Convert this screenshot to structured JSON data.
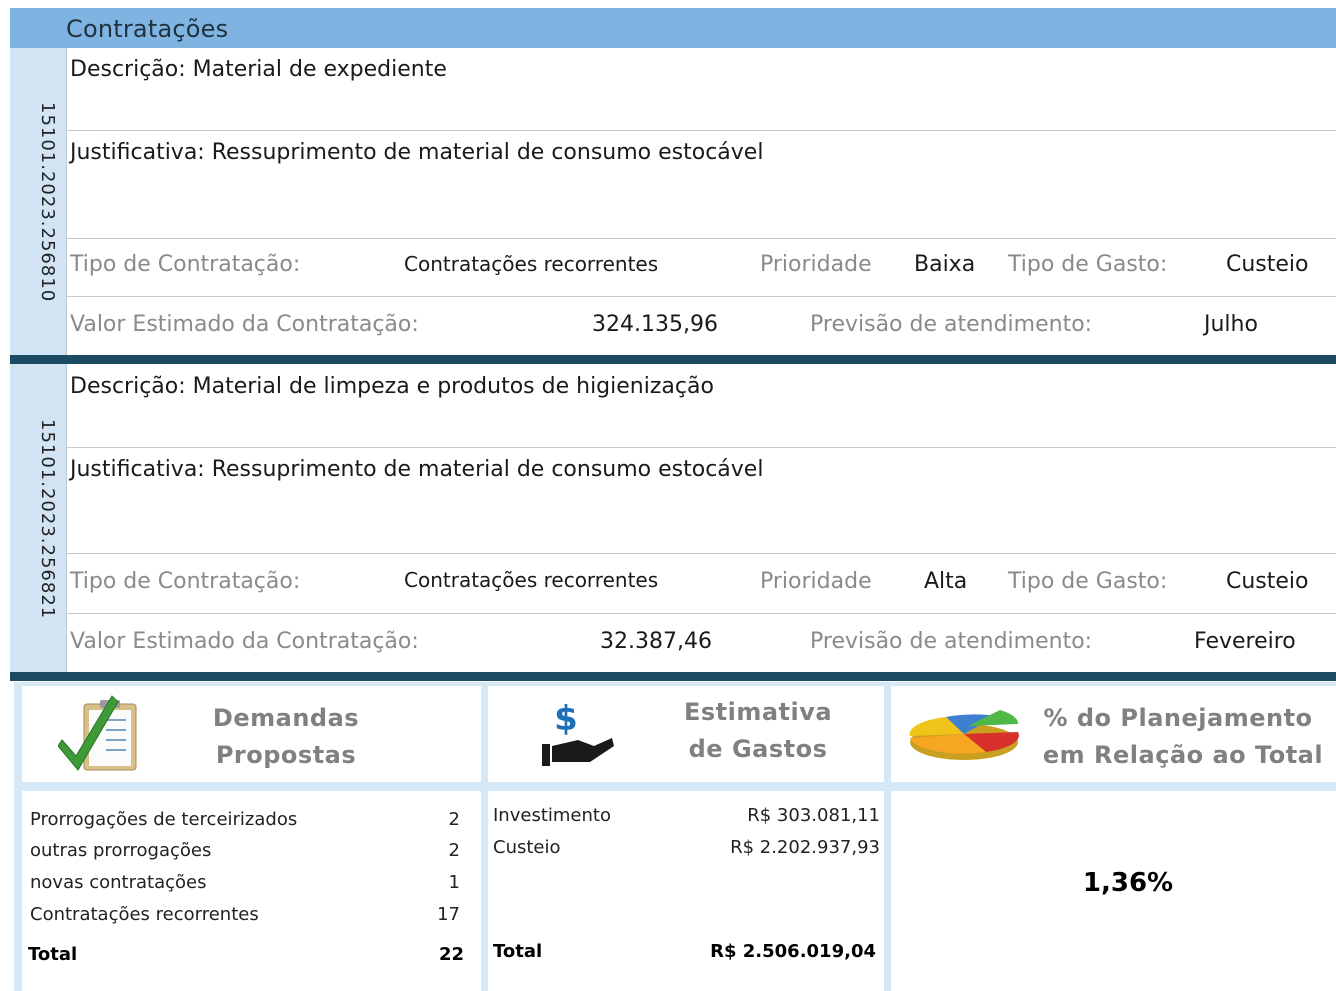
{
  "header": {
    "title": "Contratações"
  },
  "labels": {
    "tipo_contratacao": "Tipo de Contratação:",
    "prioridade": "Prioridade",
    "tipo_gasto": "Tipo de Gasto:",
    "valor_estimado": "Valor Estimado da Contratação:",
    "previsao": "Previsão de atendimento:"
  },
  "records": [
    {
      "id": "15101.2023.256810",
      "descricao": "Descrição: Material de expediente",
      "justificativa": "Justificativa: Ressuprimento de material de consumo estocável",
      "tipo_contratacao": "Contratações recorrentes",
      "prioridade": "Baixa",
      "tipo_gasto": "Custeio",
      "valor_estimado": "324.135,96",
      "previsao": "Julho"
    },
    {
      "id": "15101.2023.256821",
      "descricao": "Descrição: Material de limpeza e produtos de higienização",
      "justificativa": "Justificativa: Ressuprimento de material de consumo estocável",
      "tipo_contratacao": "Contratações recorrentes",
      "prioridade": "Alta",
      "tipo_gasto": "Custeio",
      "valor_estimado": "32.387,46",
      "previsao": "Fevereiro"
    }
  ],
  "summary": {
    "demandas": {
      "title_line1": "Demandas",
      "title_line2": "Propostas",
      "icon": "checklist-icon",
      "rows": [
        {
          "label": "Prorrogações de terceirizados",
          "value": "2"
        },
        {
          "label": "outras prorrogações",
          "value": "2"
        },
        {
          "label": "novas contratações",
          "value": "1"
        },
        {
          "label": "Contratações recorrentes",
          "value": "17"
        }
      ],
      "total_label": "Total",
      "total_value": "22"
    },
    "gastos": {
      "title_line1": "Estimativa",
      "title_line2": "de Gastos",
      "icon": "money-hand-icon",
      "dollar_glyph": "$",
      "rows": [
        {
          "label": "Investimento",
          "value": "R$ 303.081,11"
        },
        {
          "label": "Custeio",
          "value": "R$ 2.202.937,93"
        }
      ],
      "total_label": "Total",
      "total_value": "R$ 2.506.019,04"
    },
    "planejamento": {
      "title_line1": "% do Planejamento",
      "title_line2": "em Relação ao Total",
      "icon": "pie-chart-icon",
      "value": "1,36%"
    }
  },
  "colors": {
    "header_bg": "#7fb4e2",
    "separator": "#1c4a63",
    "sidebar_bg": "#d2e4f4",
    "panel_bg": "#d6e8f6",
    "label_gray": "#8a8a8a"
  }
}
